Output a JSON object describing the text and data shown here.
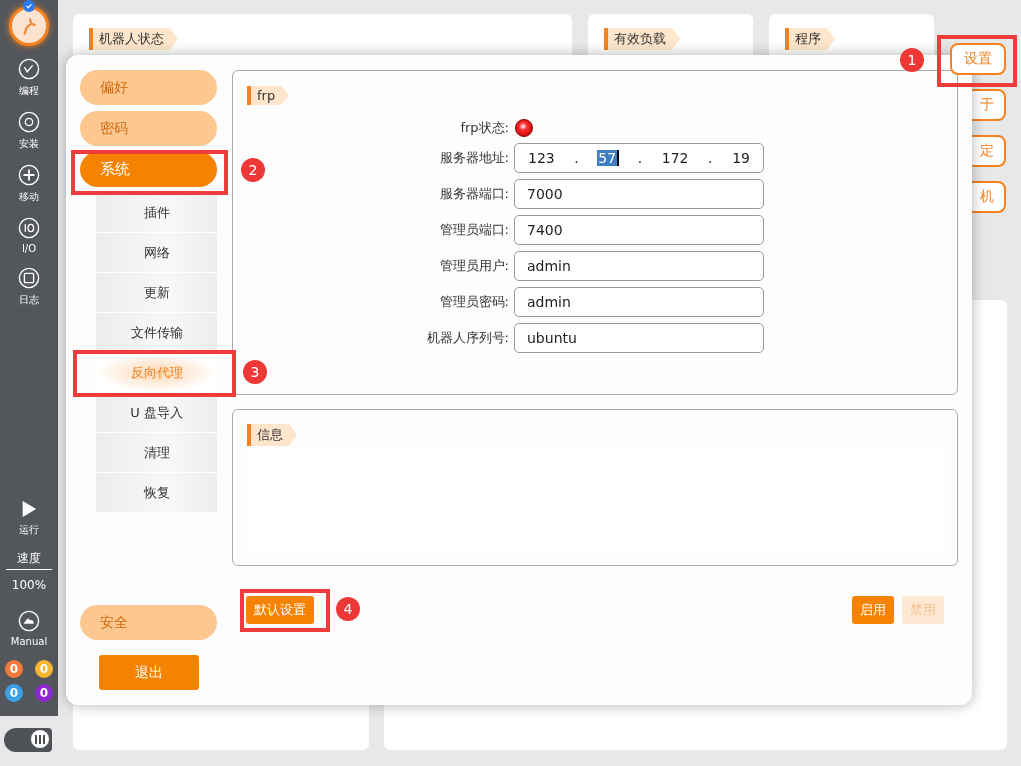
{
  "sidebar": {
    "status_checked": true,
    "toggle_on": true,
    "items": [
      {
        "label": "编程"
      },
      {
        "label": "安装"
      },
      {
        "label": "移动"
      },
      {
        "label": "I/O"
      },
      {
        "label": "日志"
      }
    ],
    "run": {
      "label": "运行"
    },
    "speed": {
      "label": "速度",
      "value": "100%"
    },
    "mode": {
      "label": "Manual"
    },
    "counters": [
      {
        "value": "0",
        "color": "#f47a3c"
      },
      {
        "value": "0",
        "color": "#f7b731"
      },
      {
        "value": "0",
        "color": "#3aa0e8"
      },
      {
        "value": "0",
        "color": "#8e2bd0"
      }
    ]
  },
  "background_cards": [
    {
      "title": "机器人状态"
    },
    {
      "title": "有效负载"
    },
    {
      "title": "程序"
    }
  ],
  "top_buttons": [
    {
      "label": "设置"
    },
    {
      "label": "于"
    },
    {
      "label": "定"
    },
    {
      "label": "机"
    }
  ],
  "settings_dialog": {
    "nav": [
      {
        "label": "偏好",
        "selected": false
      },
      {
        "label": "密码",
        "selected": false
      },
      {
        "label": "系统",
        "selected": true,
        "children": [
          {
            "label": "插件",
            "selected": false
          },
          {
            "label": "网络",
            "selected": false
          },
          {
            "label": "更新",
            "selected": false
          },
          {
            "label": "文件传输",
            "selected": false
          },
          {
            "label": "反向代理",
            "selected": true
          },
          {
            "label": "U 盘导入",
            "selected": false
          },
          {
            "label": "清理",
            "selected": false
          },
          {
            "label": "恢复",
            "selected": false
          }
        ]
      }
    ],
    "bottom_nav": {
      "label": "安全",
      "selected": false
    },
    "exit_button": "退出",
    "frp": {
      "title": "frp",
      "status": {
        "label": "frp状态:",
        "on": false
      },
      "server_address": {
        "label": "服务器地址:",
        "octets": [
          {
            "value": "123",
            "selected": false
          },
          {
            "value": "57",
            "selected": true
          },
          {
            "value": "172",
            "selected": false
          },
          {
            "value": "19",
            "selected": false
          }
        ],
        "separator": "."
      },
      "fields": [
        {
          "label": "服务器端口:",
          "value": "7000"
        },
        {
          "label": "管理员端口:",
          "value": "7400"
        },
        {
          "label": "管理员用户:",
          "value": "admin"
        },
        {
          "label": "管理员密码:",
          "value": "admin"
        },
        {
          "label": "机器人序列号:",
          "value": "ubuntu"
        }
      ]
    },
    "info": {
      "title": "信息"
    },
    "default_button": "默认设置",
    "actions": [
      {
        "label": "启用",
        "disabled": false
      },
      {
        "label": "禁用",
        "disabled": true
      }
    ]
  },
  "annotations": [
    {
      "number": "1"
    },
    {
      "number": "2"
    },
    {
      "number": "3"
    },
    {
      "number": "4"
    }
  ]
}
